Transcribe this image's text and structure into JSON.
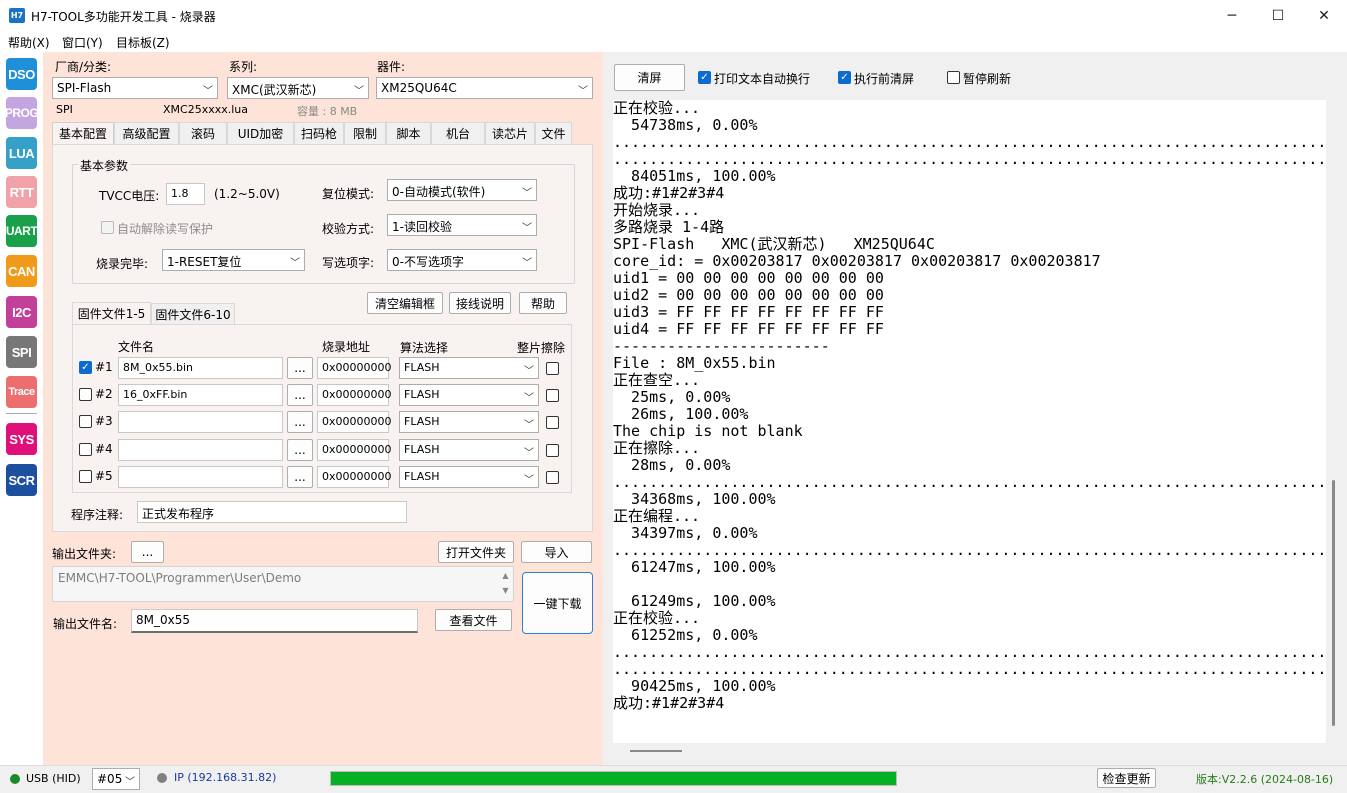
{
  "window": {
    "title": "H7-TOOL多功能开发工具 - 烧录器",
    "icon_text": "H7",
    "minimize": "─",
    "maximize": "☐",
    "close": "✕"
  },
  "menu": [
    "帮助(X)",
    "窗口(Y)",
    "目标板(Z)"
  ],
  "sidebar": [
    {
      "label": "DSO",
      "color": "#1f8fd8"
    },
    {
      "label": "PROG",
      "color": "#c3a6e0"
    },
    {
      "label": "LUA",
      "color": "#35a0c8"
    },
    {
      "label": "RTT",
      "color": "#f0a2a8"
    },
    {
      "label": "UART",
      "color": "#18a04a"
    },
    {
      "label": "CAN",
      "color": "#f09a1a"
    },
    {
      "label": "I2C",
      "color": "#c2409a"
    },
    {
      "label": "SPI",
      "color": "#777777"
    },
    {
      "label": "Trace",
      "color": "#ec6e6e"
    },
    {
      "label": "SYS",
      "color": "#e0107a"
    },
    {
      "label": "SCR",
      "color": "#1c4f9e"
    }
  ],
  "prog": {
    "vendor_label": "厂商/分类:",
    "vendor_value": "SPI-Flash",
    "series_label": "系列:",
    "series_value": "XMC(武汉新芯)",
    "device_label": "器件:",
    "device_value": "XM25QU64C",
    "info_type": "SPI",
    "info_lua": "XMC25xxxx.lua",
    "info_capacity": "容量 : 8 MB",
    "tabs": [
      "基本配置",
      "高级配置",
      "滚码",
      "UID加密",
      "扫码枪",
      "限制",
      "脚本",
      "机台",
      "读芯片",
      "文件"
    ],
    "basic_params_title": "基本参数",
    "tvcc_label": "TVCC电压:",
    "tvcc_value": "1.8",
    "tvcc_range": "(1.2~5.0V)",
    "reset_label": "复位模式:",
    "reset_value": "0-自动模式(软件)",
    "auto_unlock_label": "自动解除读写保护",
    "verify_label": "校验方式:",
    "verify_value": "1-读回校验",
    "finish_label": "烧录完毕:",
    "finish_value": "1-RESET复位",
    "option_label": "写选项字:",
    "option_value": "0-不写选项字",
    "clear_btn": "清空编辑框",
    "wiring_btn": "接线说明",
    "help_btn": "帮助",
    "fw_tab1": "固件文件1-5",
    "fw_tab2": "固件文件6-10",
    "col_name": "文件名",
    "col_addr": "烧录地址",
    "col_algo": "算法选择",
    "col_erase": "整片擦除",
    "files": [
      {
        "id": "#1",
        "checked": true,
        "name": "8M_0x55.bin",
        "addr": "0x00000000",
        "algo": "FLASH"
      },
      {
        "id": "#2",
        "checked": false,
        "name": "16_0xFF.bin",
        "addr": "0x00000000",
        "algo": "FLASH"
      },
      {
        "id": "#3",
        "checked": false,
        "name": "",
        "addr": "0x00000000",
        "algo": "FLASH"
      },
      {
        "id": "#4",
        "checked": false,
        "name": "",
        "addr": "0x00000000",
        "algo": "FLASH"
      },
      {
        "id": "#5",
        "checked": false,
        "name": "",
        "addr": "0x00000000",
        "algo": "FLASH"
      }
    ],
    "browse": "...",
    "note_label": "程序注释:",
    "note_value": "正式发布程序",
    "out_folder_label": "输出文件夹:",
    "out_folder_btn": "...",
    "open_folder_btn": "打开文件夹",
    "import_btn": "导入",
    "out_path": "EMMC\\H7-TOOL\\Programmer\\User\\Demo",
    "out_name_label": "输出文件名:",
    "out_name_value": "8M_0x55",
    "view_file_btn": "查看文件",
    "download_btn": "一键下载"
  },
  "console": {
    "clear_btn": "清屏",
    "wrap_label": "打印文本自动换行",
    "wrap_checked": true,
    "preclear_label": "执行前清屏",
    "preclear_checked": true,
    "pause_label": "暂停刷新",
    "pause_checked": false,
    "lines": [
      "正在校验...",
      "  54738ms, 0.00%",
      "..............................................................................................................",
      "..............................................................................................................",
      "  84051ms, 100.00%",
      "成功:#1#2#3#4",
      "开始烧录...",
      "多路烧录 1-4路",
      "SPI-Flash   XMC(武汉新芯)   XM25QU64C",
      "core_id: = 0x00203817 0x00203817 0x00203817 0x00203817",
      "uid1 = 00 00 00 00 00 00 00 00",
      "uid2 = 00 00 00 00 00 00 00 00",
      "uid3 = FF FF FF FF FF FF FF FF",
      "uid4 = FF FF FF FF FF FF FF FF",
      "------------------------",
      "File : 8M_0x55.bin",
      "正在查空...",
      "  25ms, 0.00%",
      "  26ms, 100.00%",
      "The chip is not blank",
      "正在擦除...",
      "  28ms, 0.00%",
      "..............................................................................................................",
      "  34368ms, 100.00%",
      "正在编程...",
      "  34397ms, 0.00%",
      "..............................................................................................................",
      "  61247ms, 100.00%",
      "",
      "  61249ms, 100.00%",
      "正在校验...",
      "  61252ms, 0.00%",
      "..............................................................................................................",
      "..............................................................................................................",
      "  90425ms, 100.00%",
      "成功:#1#2#3#4"
    ]
  },
  "status": {
    "usb": "USB (HID)",
    "usb_color": "#1a8a2a",
    "port": "#05",
    "ip": "IP (192.168.31.82)",
    "ip_color": "#808080",
    "progress": 1.0,
    "progress_color": "#06b025",
    "update_btn": "检查更新",
    "version": "版本:V2.2.6 (2024-08-16)",
    "version_color": "#2a7a1a"
  }
}
